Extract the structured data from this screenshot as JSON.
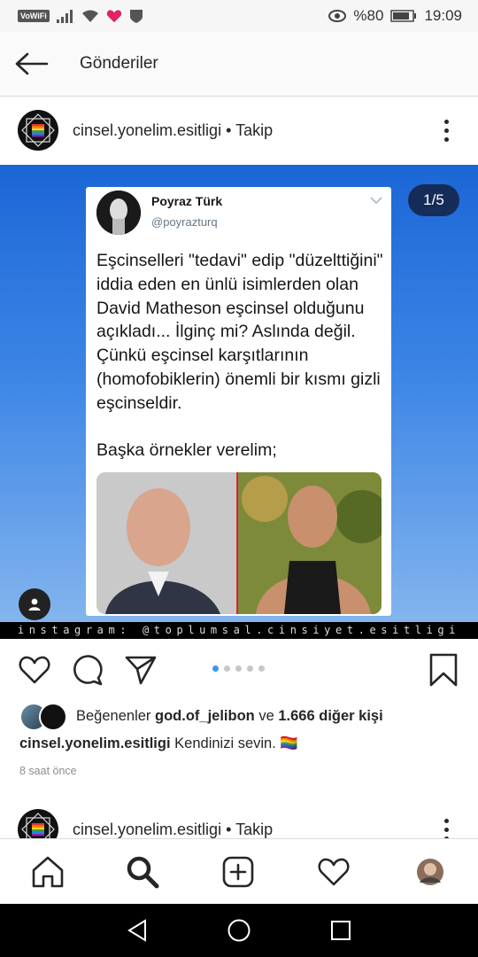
{
  "status_bar": {
    "volte": "VoWiFi",
    "battery": "%80",
    "time": "19:09"
  },
  "header": {
    "title": "Gönderiler"
  },
  "post": {
    "account": "cinsel.yonelim.esitligi",
    "follow_label": "• Takip",
    "counter": "1/5",
    "tweet": {
      "name": "Poyraz Türk",
      "handle": "@poyrazturq",
      "text": "Eşcinselleri \"tedavi\" edip \"düzelttiğini\" iddia eden en ünlü isimlerden olan David Matheson eşcinsel olduğunu açıkladı... İlginç mi? Aslında değil. Çünkü eşcinsel karşıtlarının (homofobiklerin) önemli bir kısmı gizli eşcinseldir.\n\nBaşka örnekler verelim;"
    },
    "watermark": "instagram: @toplumsal.cinsiyet.esitligi",
    "pager": {
      "count": 5,
      "active": 1
    },
    "likes": {
      "prefix": "Beğenenler",
      "user": "god.of_jelibon",
      "conj": "ve",
      "others": "1.666 diğer kişi"
    },
    "caption": {
      "account": "cinsel.yonelim.esitligi",
      "text": "Kendinizi sevin. 🏳️‍🌈"
    },
    "time": "8 saat önce"
  },
  "next_post": {
    "account": "cinsel.yonelim.esitligi",
    "follow_label": "• Takip"
  },
  "colors": {
    "accent": "#3897f0",
    "heart_status": "#e0245e"
  }
}
